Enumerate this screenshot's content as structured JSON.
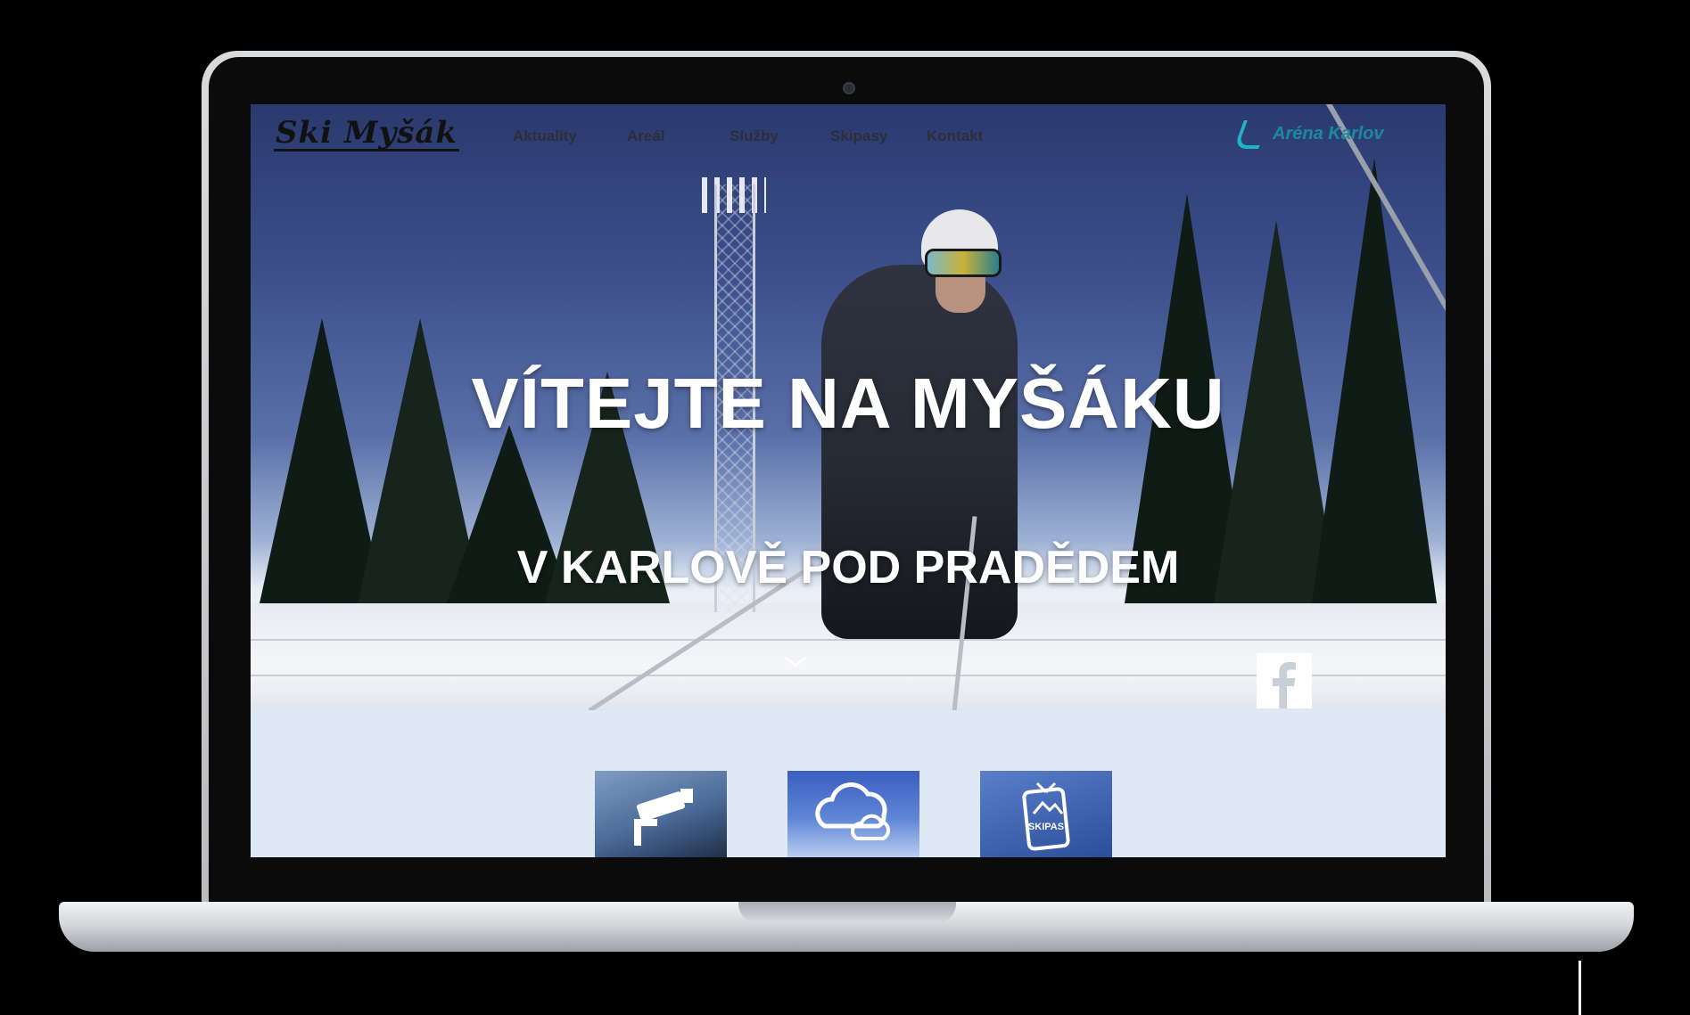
{
  "site": {
    "logo_text": "Ski Myšák",
    "nav": [
      {
        "label": "Aktuality"
      },
      {
        "label": "Areál"
      },
      {
        "label": "Služby"
      },
      {
        "label": "Skipasy"
      },
      {
        "label": "Kontakt"
      }
    ],
    "partner_logo_text": "Aréna Karlov",
    "accent_color": "#1fb5c6"
  },
  "hero": {
    "title": "VÍTEJTE NA MYŠÁKU",
    "subtitle": "V KARLOVĚ POD PRADĚDEM",
    "scroll_icon": "chevron-down-icon",
    "social_icon": "facebook-icon"
  },
  "tiles": [
    {
      "icon": "webcam-icon"
    },
    {
      "icon": "weather-icon"
    },
    {
      "icon": "skipass-icon",
      "label": "SKIPAS"
    }
  ]
}
